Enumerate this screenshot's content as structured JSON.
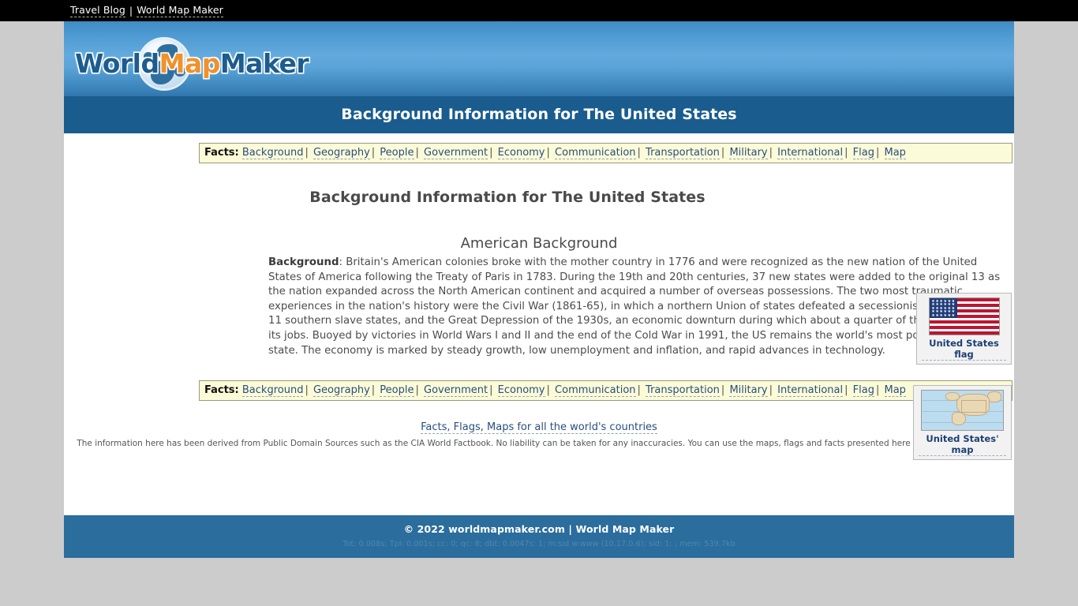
{
  "topbar": {
    "links": [
      {
        "label": "Travel Blog"
      },
      {
        "label": "World Map Maker"
      }
    ],
    "separator": "|"
  },
  "logo": {
    "part1": "World",
    "part2": "Map",
    "part3": "Maker",
    "colors": {
      "blue": "#1d5c8e",
      "orange": "#f0922b"
    }
  },
  "banner": {
    "title": "Background Information for The United States",
    "background_color": "#1a5c8e"
  },
  "facts_nav": {
    "label": "Facts:",
    "separator": "|",
    "items": [
      {
        "label": "Background"
      },
      {
        "label": "Geography"
      },
      {
        "label": "People"
      },
      {
        "label": "Government"
      },
      {
        "label": "Economy"
      },
      {
        "label": "Communication"
      },
      {
        "label": "Transportation"
      },
      {
        "label": "Military"
      },
      {
        "label": "International"
      },
      {
        "label": "Flag"
      },
      {
        "label": "Map"
      }
    ]
  },
  "main": {
    "heading": "Background Information for The United States",
    "sub_heading": "American Background",
    "paragraph_label": "Background",
    "paragraph_separator": ": ",
    "paragraph": "Britain's American colonies broke with the mother country in 1776 and were recognized as the new nation of the United States of America following the Treaty of Paris in 1783. During the 19th and 20th centuries, 37 new states were added to the original 13 as the nation expanded across the North American continent and acquired a number of overseas possessions. The two most traumatic experiences in the nation's history were the Civil War (1861-65), in which a northern Union of states defeated a secessionist Confederacy of 11 southern slave states, and the Great Depression of the 1930s, an economic downturn during which about a quarter of the labor force lost its jobs. Buoyed by victories in World Wars I and II and the end of the Cold War in 1991, the US remains the world's most powerful nation state. The economy is marked by steady growth, low unemployment and inflation, and rapid advances in technology."
  },
  "thumbnails": {
    "flag": {
      "caption": "United States flag"
    },
    "map": {
      "caption": "United States' map"
    }
  },
  "footer_links": {
    "text": "Facts, Flags, Maps for all the world's countries"
  },
  "disclaimer": {
    "text": "The information here has been derived from Public Domain Sources such as the CIA World Factbook. No liability can be taken for any inaccuracies. You can use the maps, flags and facts presented here however you choose."
  },
  "footer": {
    "copyright": "© 2022 worldmapmaker.com | World Map Maker",
    "debug": "Tot: 0.008s; Tpl: 0.001s; cc: 0; qc: 8; dbt: 0.0047s; 1; m:sid w:www (10.17.0.6); sid: 1; ; mem: 539.7kb",
    "background_color": "#2b6d9c"
  }
}
